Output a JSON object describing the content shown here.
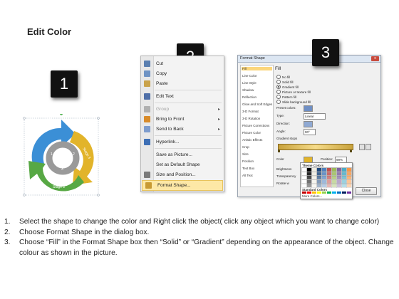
{
  "title": "Edit Color",
  "steps": [
    {
      "badge": "1"
    },
    {
      "badge": "2"
    },
    {
      "badge": "3"
    }
  ],
  "diagram": {
    "stage_labels": [
      "Stage 1",
      "Stage 2",
      "Stage 3"
    ],
    "center_numbers": [
      "1",
      "2",
      "3"
    ],
    "colors": {
      "blue": "#3b8fd6",
      "yellow": "#e2b42a",
      "green": "#57a844",
      "inner": "#9a9a9a"
    }
  },
  "context_menu": {
    "items": [
      {
        "label": "Cut",
        "icon": "scissors-icon",
        "color": "#5a7fb0"
      },
      {
        "label": "Copy",
        "icon": "copy-icon",
        "color": "#6f93c4"
      },
      {
        "label": "Paste",
        "icon": "paste-icon",
        "color": "#c9a24a"
      },
      {
        "label": "Edit Text",
        "icon": "edit-text-icon",
        "color": "#4f6fa8"
      },
      {
        "label": "Group",
        "icon": "group-icon",
        "color": "#b0b0b0",
        "disabled": true,
        "submenu": true
      },
      {
        "label": "Bring to Front",
        "icon": "bring-front-icon",
        "color": "#d88b2a",
        "submenu": true
      },
      {
        "label": "Send to Back",
        "icon": "send-back-icon",
        "color": "#7d9ccd",
        "submenu": true
      },
      {
        "label": "Hyperlink...",
        "icon": "hyperlink-icon",
        "color": "#3d6fb5"
      },
      {
        "label": "Save as Picture...",
        "icon": "",
        "color": ""
      },
      {
        "label": "Set as Default Shape",
        "icon": "",
        "color": ""
      },
      {
        "label": "Size and Position...",
        "icon": "size-position-icon",
        "color": "#7a7a7a"
      },
      {
        "label": "Format Shape...",
        "icon": "format-shape-icon",
        "color": "#c89a34",
        "highlighted": true
      }
    ]
  },
  "format_dialog": {
    "title": "Format Shape",
    "close_x": "x",
    "side_items": [
      "Fill",
      "Line Color",
      "Line Style",
      "Shadow",
      "Reflection",
      "Glow and Soft Edges",
      "3-D Format",
      "3-D Rotation",
      "Picture Corrections",
      "Picture Color",
      "Artistic Effects",
      "Crop",
      "Size",
      "Position",
      "Text Box",
      "Alt Text"
    ],
    "fill_heading": "Fill",
    "fill_options": [
      "No fill",
      "Solid fill",
      "Gradient fill",
      "Picture or texture fill",
      "Pattern fill",
      "Slide background fill"
    ],
    "selected_fill": "Gradient fill",
    "preset_colors_label": "Preset colors:",
    "type_label": "Type:",
    "type_value": "Linear",
    "direction_label": "Direction:",
    "angle_label": "Angle:",
    "angle_value": "90°",
    "gradient_stops_label": "Gradient stops",
    "color_label": "Color",
    "position_label": "Position:",
    "position_value": "99%",
    "brightness_label": "Brightness",
    "transparency_label": "Transparency",
    "rotate_label": "Rotate w",
    "theme_colors_label": "Theme Colors",
    "standard_colors_label": "Standard Colors",
    "more_colors_label": "More Colors...",
    "close_button": "Close"
  },
  "instructions": [
    {
      "num": "1.",
      "text": "Select the shape to change the color and Right click the object( click any object which you want to change color)"
    },
    {
      "num": "2.",
      "text": "Choose Format Shape in the dialog box."
    },
    {
      "num": "3.",
      "text": "Choose “Fill” in the Format Shape box then “Solid” or “Gradient” depending on the appearance of the object. Change colour as shown in the picture."
    }
  ]
}
